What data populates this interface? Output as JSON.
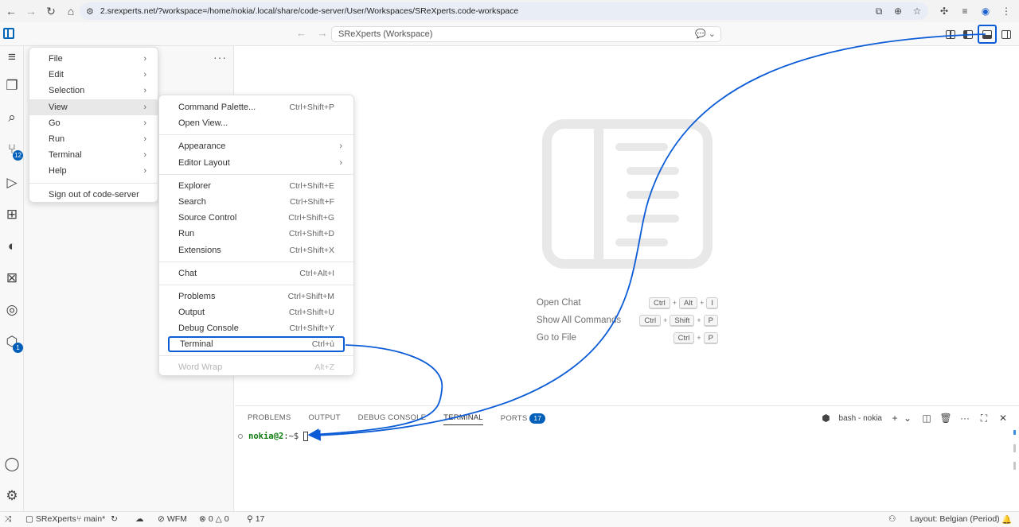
{
  "browser": {
    "url": "2.srexperts.net/?workspace=/home/nokia/.local/share/code-server/User/Workspaces/SReXperts.code-workspace"
  },
  "titlebar": {
    "command_center": "SReXperts (Workspace)"
  },
  "activity": {
    "source_control_badge": "12",
    "extension_badge": "1"
  },
  "main_menu": {
    "items": [
      {
        "label": "File"
      },
      {
        "label": "Edit"
      },
      {
        "label": "Selection"
      },
      {
        "label": "View"
      },
      {
        "label": "Go"
      },
      {
        "label": "Run"
      },
      {
        "label": "Terminal"
      },
      {
        "label": "Help"
      }
    ],
    "sign_out": "Sign out of code-server"
  },
  "view_menu": {
    "command_palette": {
      "label": "Command Palette...",
      "kb": "Ctrl+Shift+P"
    },
    "open_view": {
      "label": "Open View..."
    },
    "appearance": {
      "label": "Appearance"
    },
    "editor_layout": {
      "label": "Editor Layout"
    },
    "explorer": {
      "label": "Explorer",
      "kb": "Ctrl+Shift+E"
    },
    "search": {
      "label": "Search",
      "kb": "Ctrl+Shift+F"
    },
    "source_control": {
      "label": "Source Control",
      "kb": "Ctrl+Shift+G"
    },
    "run": {
      "label": "Run",
      "kb": "Ctrl+Shift+D"
    },
    "extensions": {
      "label": "Extensions",
      "kb": "Ctrl+Shift+X"
    },
    "chat": {
      "label": "Chat",
      "kb": "Ctrl+Alt+I"
    },
    "problems": {
      "label": "Problems",
      "kb": "Ctrl+Shift+M"
    },
    "output": {
      "label": "Output",
      "kb": "Ctrl+Shift+U"
    },
    "debug_console": {
      "label": "Debug Console",
      "kb": "Ctrl+Shift+Y"
    },
    "terminal": {
      "label": "Terminal",
      "kb": "Ctrl+ù"
    },
    "word_wrap": {
      "label": "Word Wrap",
      "kb": "Alt+Z"
    }
  },
  "shortcuts": {
    "open_chat": {
      "label": "Open Chat",
      "keys": [
        "Ctrl",
        "Alt",
        "I"
      ]
    },
    "show_all": {
      "label": "Show All Commands",
      "keys": [
        "Ctrl",
        "Shift",
        "P"
      ]
    },
    "go_to_file": {
      "label": "Go to File",
      "keys": [
        "Ctrl",
        "P"
      ]
    }
  },
  "panel": {
    "tabs": {
      "problems": "PROBLEMS",
      "output": "OUTPUT",
      "debug_console": "DEBUG CONSOLE",
      "terminal": "TERMINAL",
      "ports": "PORTS",
      "ports_count": "17"
    },
    "terminal_name": "bash - nokia",
    "prompt_user": "nokia@2",
    "prompt_path": ":~$"
  },
  "status": {
    "workspace": "SReXperts",
    "branch": "main*",
    "wfm": "WFM",
    "errors": "0",
    "warnings": "0",
    "ports": "17",
    "layout": "Layout: Belgian (Period)"
  },
  "colors": {
    "accent": "#005fb8",
    "highlight_box": "#0b5cd6",
    "terminal_user": "#0f7b0f"
  }
}
